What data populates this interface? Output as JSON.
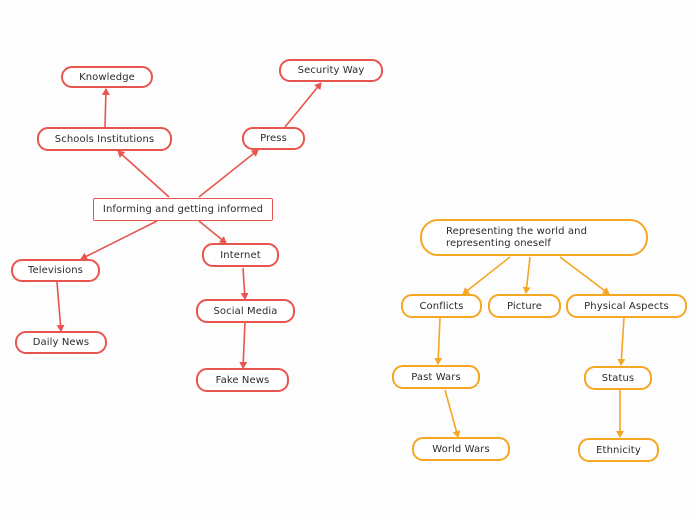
{
  "colors": {
    "red_branch": "#e8554e",
    "orange_branch": "#f5a623",
    "text": "#2b2b2b",
    "background": "#fdfdfd"
  },
  "mindmap_left": {
    "root": "Informing and getting informed",
    "nodes": {
      "schools": "Schools Institutions",
      "knowledge": "Knowledge",
      "press": "Press",
      "security": "Security Way",
      "televisions": "Televisions",
      "daily_news": "Daily News",
      "internet": "Internet",
      "social_media": "Social Media",
      "fake_news": "Fake News"
    },
    "edges": [
      [
        "root",
        "schools"
      ],
      [
        "schools",
        "knowledge"
      ],
      [
        "root",
        "press"
      ],
      [
        "press",
        "security"
      ],
      [
        "root",
        "televisions"
      ],
      [
        "televisions",
        "daily_news"
      ],
      [
        "root",
        "internet"
      ],
      [
        "internet",
        "social_media"
      ],
      [
        "social_media",
        "fake_news"
      ]
    ]
  },
  "mindmap_right": {
    "root": "Representing the world and representing oneself",
    "nodes": {
      "conflicts": "Conflicts",
      "picture": "Picture",
      "physical": "Physical Aspects",
      "past_wars": "Past Wars",
      "world_wars": "World Wars",
      "status": "Status",
      "ethnicity": "Ethnicity"
    },
    "edges": [
      [
        "root",
        "conflicts"
      ],
      [
        "root",
        "picture"
      ],
      [
        "root",
        "physical"
      ],
      [
        "conflicts",
        "past_wars"
      ],
      [
        "past_wars",
        "world_wars"
      ],
      [
        "physical",
        "status"
      ],
      [
        "status",
        "ethnicity"
      ]
    ]
  }
}
